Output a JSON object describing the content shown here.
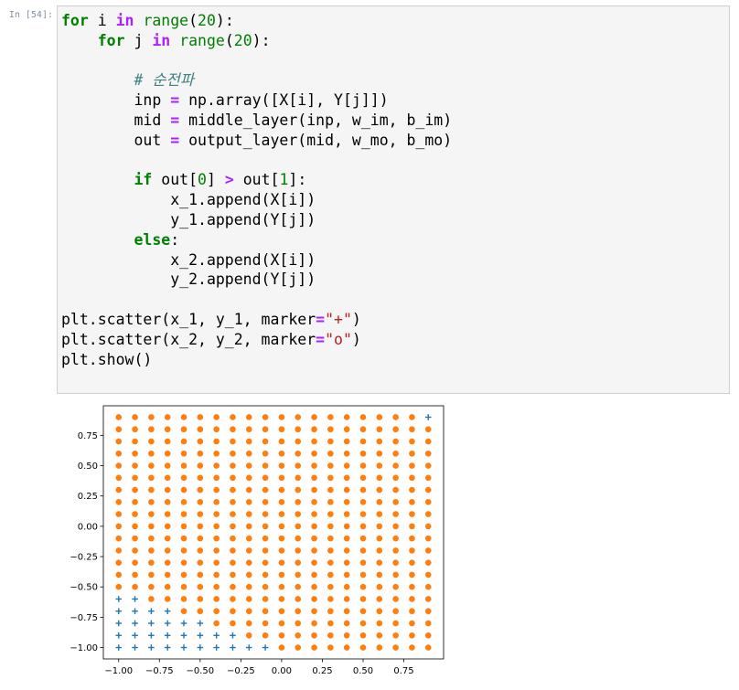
{
  "cell": {
    "prompt": "In [54]:",
    "code_lines": [
      [
        {
          "t": "for",
          "c": "kw"
        },
        {
          "t": " i "
        },
        {
          "t": "in",
          "c": "op"
        },
        {
          "t": " "
        },
        {
          "t": "range",
          "c": "bi"
        },
        {
          "t": "("
        },
        {
          "t": "20",
          "c": "num"
        },
        {
          "t": "):"
        }
      ],
      [
        {
          "t": "    "
        },
        {
          "t": "for",
          "c": "kw"
        },
        {
          "t": " j "
        },
        {
          "t": "in",
          "c": "op"
        },
        {
          "t": " "
        },
        {
          "t": "range",
          "c": "bi"
        },
        {
          "t": "("
        },
        {
          "t": "20",
          "c": "num"
        },
        {
          "t": "):"
        }
      ],
      [],
      [
        {
          "t": "        "
        },
        {
          "t": "# 순전파",
          "c": "cm"
        }
      ],
      [
        {
          "t": "        inp "
        },
        {
          "t": "=",
          "c": "op"
        },
        {
          "t": " np.array([X[i], Y[j]])"
        }
      ],
      [
        {
          "t": "        mid "
        },
        {
          "t": "=",
          "c": "op"
        },
        {
          "t": " middle_layer(inp, w_im, b_im)"
        }
      ],
      [
        {
          "t": "        out "
        },
        {
          "t": "=",
          "c": "op"
        },
        {
          "t": " output_layer(mid, w_mo, b_mo)"
        }
      ],
      [],
      [
        {
          "t": "        "
        },
        {
          "t": "if",
          "c": "kw"
        },
        {
          "t": " out["
        },
        {
          "t": "0",
          "c": "num"
        },
        {
          "t": "] "
        },
        {
          "t": ">",
          "c": "op"
        },
        {
          "t": " out["
        },
        {
          "t": "1",
          "c": "num"
        },
        {
          "t": "]:"
        }
      ],
      [
        {
          "t": "            x_1.append(X[i])"
        }
      ],
      [
        {
          "t": "            y_1.append(Y[j])"
        }
      ],
      [
        {
          "t": "        "
        },
        {
          "t": "else",
          "c": "kw"
        },
        {
          "t": ":"
        }
      ],
      [
        {
          "t": "            x_2.append(X[i])"
        }
      ],
      [
        {
          "t": "            y_2.append(Y[j])"
        }
      ],
      [],
      [
        {
          "t": "plt.scatter(x_1, y_1, marker"
        },
        {
          "t": "=",
          "c": "op"
        },
        {
          "t": "\"+\"",
          "c": "str"
        },
        {
          "t": ")"
        }
      ],
      [
        {
          "t": "plt.scatter(x_2, y_2, marker"
        },
        {
          "t": "=",
          "c": "op"
        },
        {
          "t": "\"o\"",
          "c": "str"
        },
        {
          "t": ")"
        }
      ],
      [
        {
          "t": "plt.show()"
        }
      ]
    ]
  },
  "colors": {
    "series_plus": "#1f77b4",
    "series_circle": "#ff7f0e"
  },
  "chart_data": {
    "type": "scatter",
    "title": "",
    "xlabel": "",
    "ylabel": "",
    "grid": false,
    "legend": "none",
    "xlim": [
      -1.094,
      0.994
    ],
    "ylim": [
      -1.094,
      0.994
    ],
    "xticks": [
      -1.0,
      -0.75,
      -0.5,
      -0.25,
      0.0,
      0.25,
      0.5,
      0.75
    ],
    "yticks": [
      -1.0,
      -0.75,
      -0.5,
      -0.25,
      0.0,
      0.25,
      0.5,
      0.75
    ],
    "xtick_labels": [
      "−1.00",
      "−0.75",
      "−0.50",
      "−0.25",
      "0.00",
      "0.25",
      "0.50",
      "0.75"
    ],
    "ytick_labels": [
      "−1.00",
      "−0.75",
      "−0.50",
      "−0.25",
      "0.00",
      "0.25",
      "0.50",
      "0.75"
    ],
    "grid_values": [
      -1.0,
      -0.9,
      -0.8,
      -0.7,
      -0.6,
      -0.5,
      -0.4,
      -0.3,
      -0.2,
      -0.1,
      0.0,
      0.1,
      0.2,
      0.3,
      0.4,
      0.5,
      0.6,
      0.7,
      0.8,
      0.9
    ],
    "series": [
      {
        "marker": "+",
        "color": "#1f77b4",
        "points": [
          [
            -1.0,
            -1.0
          ],
          [
            -1.0,
            -0.9
          ],
          [
            -1.0,
            -0.8
          ],
          [
            -1.0,
            -0.7
          ],
          [
            -1.0,
            -0.6
          ],
          [
            -0.9,
            -1.0
          ],
          [
            -0.9,
            -0.9
          ],
          [
            -0.9,
            -0.8
          ],
          [
            -0.9,
            -0.7
          ],
          [
            -0.9,
            -0.6
          ],
          [
            -0.8,
            -1.0
          ],
          [
            -0.8,
            -0.9
          ],
          [
            -0.8,
            -0.8
          ],
          [
            -0.8,
            -0.7
          ],
          [
            -0.7,
            -1.0
          ],
          [
            -0.7,
            -0.9
          ],
          [
            -0.7,
            -0.8
          ],
          [
            -0.7,
            -0.7
          ],
          [
            -0.6,
            -1.0
          ],
          [
            -0.6,
            -0.9
          ],
          [
            -0.6,
            -0.8
          ],
          [
            -0.5,
            -1.0
          ],
          [
            -0.5,
            -0.9
          ],
          [
            -0.5,
            -0.8
          ],
          [
            -0.4,
            -1.0
          ],
          [
            -0.4,
            -0.9
          ],
          [
            -0.3,
            -1.0
          ],
          [
            -0.3,
            -0.9
          ],
          [
            -0.2,
            -1.0
          ],
          [
            -0.1,
            -1.0
          ],
          [
            0.9,
            0.9
          ]
        ]
      },
      {
        "marker": "o",
        "color": "#ff7f0e",
        "points": "all remaining points of the 20x20 grid"
      }
    ]
  }
}
